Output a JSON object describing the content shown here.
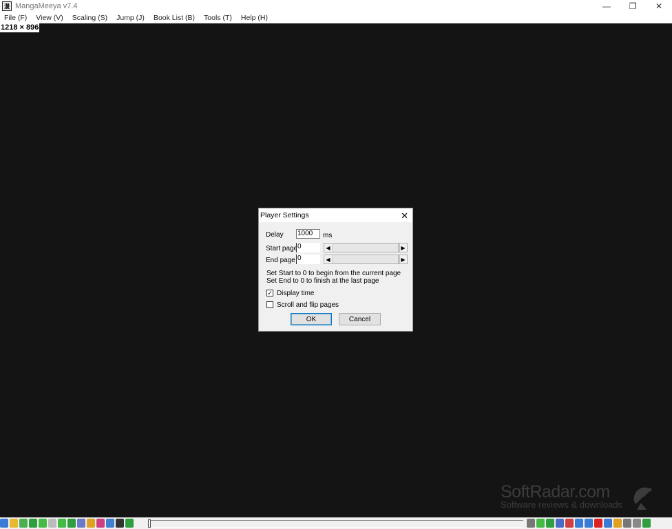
{
  "window": {
    "title": "MangaMeeya v7.4",
    "app_icon": "manga-book-icon",
    "controls": [
      {
        "name": "minimize-button",
        "icon": "minimize-icon",
        "glyph": "—"
      },
      {
        "name": "restore-button",
        "icon": "restore-icon",
        "glyph": "❐"
      },
      {
        "name": "close-button",
        "icon": "close-icon",
        "glyph": "✕"
      }
    ]
  },
  "menu": {
    "items": [
      "File (F)",
      "View (V)",
      "Scaling (S)",
      "Jump (J)",
      "Book List (B)",
      "Tools (T)",
      "Help (H)"
    ]
  },
  "viewer": {
    "dimensions": "1218 × 896",
    "background": "#141414"
  },
  "dialog": {
    "title": "Player Settings",
    "close_glyph": "✕",
    "delay_label": "Delay",
    "delay_value": "1000",
    "delay_unit": "ms",
    "start_label": "Start page",
    "start_value": "0",
    "end_label": "End page",
    "end_value": "0",
    "hint_start": "Set Start to 0 to begin from the current page",
    "hint_end": "Set End to 0 to finish at the last page",
    "display_time_label": "Display time",
    "display_time_checked": true,
    "scroll_flip_label": "Scroll and flip pages",
    "scroll_flip_checked": false,
    "ok_label": "OK",
    "cancel_label": "Cancel"
  },
  "watermark": {
    "brand": "SoftRadar.com",
    "tagline": "Software reviews & downloads",
    "icon": "satellite-dish-icon"
  },
  "toolbar": {
    "left_icons": [
      {
        "name": "open-file-icon",
        "color": "#3a7bd5"
      },
      {
        "name": "open-folder-icon",
        "color": "#e8b830"
      },
      {
        "name": "up-folder-icon",
        "color": "#4caf50"
      },
      {
        "name": "refresh-icon",
        "color": "#2e9e3e"
      },
      {
        "name": "back-icon",
        "color": "#44bb44"
      },
      {
        "name": "play-icon",
        "color": "#bbbbbb"
      },
      {
        "name": "forward-icon",
        "color": "#44bb44"
      },
      {
        "name": "next-folder-icon",
        "color": "#2e9e3e"
      },
      {
        "name": "fit-width-icon",
        "color": "#6a7ac8"
      },
      {
        "name": "bookmark-icon",
        "color": "#e0a020"
      },
      {
        "name": "rotate-left-icon",
        "color": "#d04080"
      },
      {
        "name": "rotate-right-icon",
        "color": "#4080d0"
      },
      {
        "name": "zoom-icon",
        "color": "#333333"
      },
      {
        "name": "first-page-icon",
        "color": "#2e9e3e"
      }
    ],
    "right_icons": [
      {
        "name": "spread-icon",
        "color": "#777777"
      },
      {
        "name": "page-mode-icon",
        "color": "#44bb44"
      },
      {
        "name": "double-page-icon",
        "color": "#2e9e3e"
      },
      {
        "name": "save-icon",
        "color": "#4a6ac8"
      },
      {
        "name": "camera-icon",
        "color": "#d04040"
      },
      {
        "name": "grid-icon",
        "color": "#3a7bd5"
      },
      {
        "name": "copy-icon",
        "color": "#3a7bd5"
      },
      {
        "name": "delete-icon",
        "color": "#dd2222"
      },
      {
        "name": "list-icon",
        "color": "#3a7bd5"
      },
      {
        "name": "thumbnail-icon",
        "color": "#e0a020"
      },
      {
        "name": "details-icon",
        "color": "#777777"
      },
      {
        "name": "settings-icon",
        "color": "#888888"
      },
      {
        "name": "minimize-tray-icon",
        "color": "#2e9e3e"
      }
    ]
  }
}
